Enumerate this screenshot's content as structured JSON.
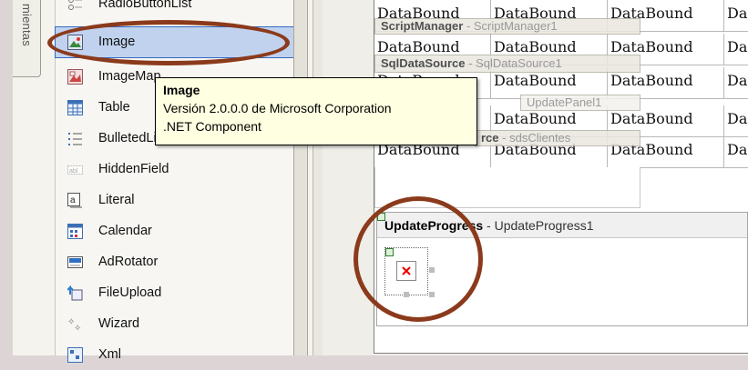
{
  "toolbox": {
    "tab_label": "mientas",
    "items": [
      {
        "label": "RadioButtonList",
        "icon": "radiobuttonlist-icon"
      },
      {
        "label": "Image",
        "icon": "image-icon",
        "selected": true
      },
      {
        "label": "ImageMap",
        "icon": "imagemap-icon"
      },
      {
        "label": "Table",
        "icon": "table-icon"
      },
      {
        "label": "BulletedList",
        "icon": "bulletedlist-icon"
      },
      {
        "label": "HiddenField",
        "icon": "hiddenfield-icon"
      },
      {
        "label": "Literal",
        "icon": "literal-icon"
      },
      {
        "label": "Calendar",
        "icon": "calendar-icon"
      },
      {
        "label": "AdRotator",
        "icon": "adrotator-icon"
      },
      {
        "label": "FileUpload",
        "icon": "fileupload-icon"
      },
      {
        "label": "Wizard",
        "icon": "wizard-icon"
      },
      {
        "label": "Xml",
        "icon": "xml-icon"
      }
    ]
  },
  "tooltip": {
    "title": "Image",
    "version": "Versión 2.0.0.0 de Microsoft Corporation",
    "kind": ".NET Component"
  },
  "designer": {
    "grid_cell_text": "DataBound",
    "grid_last_col_text": "Da",
    "script_manager": {
      "name": "ScriptManager",
      "id": " - ScriptManager1"
    },
    "sql_datasource": {
      "name": "SqlDataSource",
      "id": " - SqlDataSource1"
    },
    "update_panel": {
      "name": "UpdatePanel1"
    },
    "object_source": {
      "name": "rce",
      "id": " - sdsClientes"
    },
    "update_progress": {
      "name": "UpdateProgress",
      "id": " - UpdateProgress1"
    }
  },
  "colors": {
    "annotation_ring": "#8b3a1c",
    "selection": "#c1d2ee",
    "tooltip_bg": "#ffffe1"
  }
}
